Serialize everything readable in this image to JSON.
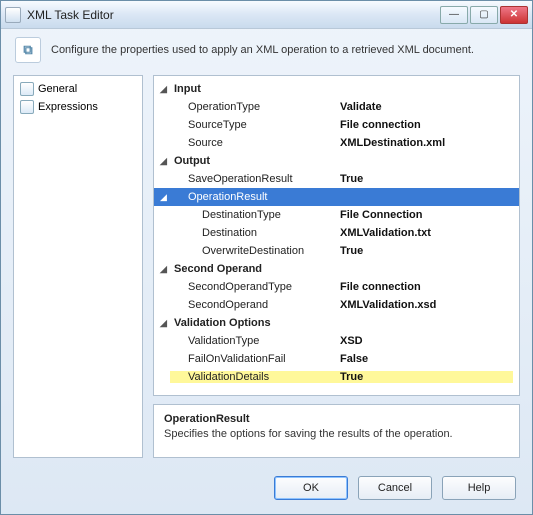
{
  "title": "XML Task Editor",
  "description": "Configure the properties used to apply an XML operation to a retrieved XML document.",
  "sidebar": {
    "items": [
      {
        "label": "General"
      },
      {
        "label": "Expressions"
      }
    ]
  },
  "grid": {
    "sections": [
      {
        "name": "Input",
        "rows": [
          {
            "label": "OperationType",
            "value": "Validate"
          },
          {
            "label": "SourceType",
            "value": "File connection"
          },
          {
            "label": "Source",
            "value": "XMLDestination.xml"
          }
        ]
      },
      {
        "name": "Output",
        "rows": [
          {
            "label": "SaveOperationResult",
            "value": "True"
          }
        ],
        "subsection": {
          "name": "OperationResult",
          "selected": true,
          "rows": [
            {
              "label": "DestinationType",
              "value": "File Connection"
            },
            {
              "label": "Destination",
              "value": "XMLValidation.txt"
            },
            {
              "label": "OverwriteDestination",
              "value": "True"
            }
          ]
        }
      },
      {
        "name": "Second Operand",
        "rows": [
          {
            "label": "SecondOperandType",
            "value": "File connection"
          },
          {
            "label": "SecondOperand",
            "value": "XMLValidation.xsd"
          }
        ]
      },
      {
        "name": "Validation Options",
        "rows": [
          {
            "label": "ValidationType",
            "value": "XSD"
          },
          {
            "label": "FailOnValidationFail",
            "value": "False"
          },
          {
            "label": "ValidationDetails",
            "value": "True",
            "highlight": true
          }
        ]
      }
    ]
  },
  "help": {
    "title": "OperationResult",
    "text": "Specifies the options for saving the results of the operation."
  },
  "buttons": {
    "ok": "OK",
    "cancel": "Cancel",
    "help": "Help"
  },
  "glyphs": {
    "collapse": "◢",
    "min": "—",
    "max": "▢",
    "close": "✕"
  }
}
